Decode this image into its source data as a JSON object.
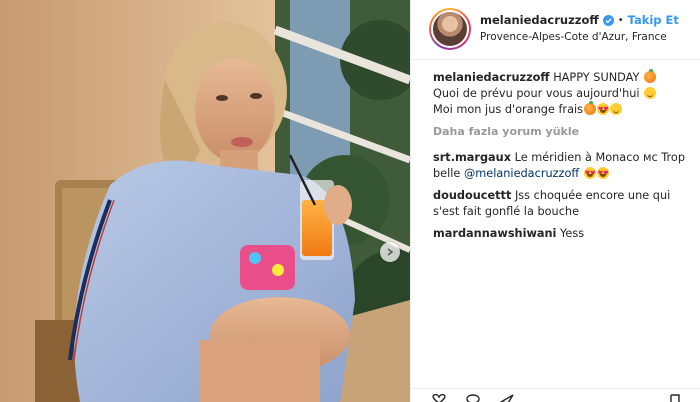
{
  "post": {
    "username": "melaniedacruzzoff",
    "follow_label": "Takip Et",
    "separator": "•",
    "location": "Provence-Alpes-Cote d'Azur, France"
  },
  "caption": {
    "username": "melaniedacruzzoff",
    "line1": "HAPPY SUNDAY",
    "line2": "Quoi de prévu pour vous aujourd'hui",
    "line3": "Moi mon jus d'orange frais"
  },
  "load_more_label": "Daha fazla yorum yükle",
  "comments": [
    {
      "username": "srt.margaux",
      "text": "Le méridien à Monaco ᴍᴄ Trop belle",
      "mention": "@melaniedacruzzoff"
    },
    {
      "username": "doudoucettt",
      "text": "Jss choquée encore une qui s'est fait gonflé la bouche"
    },
    {
      "username": "mardannawshiwani",
      "text": "Yess"
    }
  ],
  "icons": {
    "verified": "verified-badge-icon",
    "like": "heart-icon",
    "comment": "comment-icon",
    "share": "share-icon",
    "save": "bookmark-icon",
    "carousel": "carousel-next-icon"
  },
  "colors": {
    "follow_blue": "#3897f0",
    "mention_blue": "#003569",
    "muted_gray": "#999999"
  }
}
